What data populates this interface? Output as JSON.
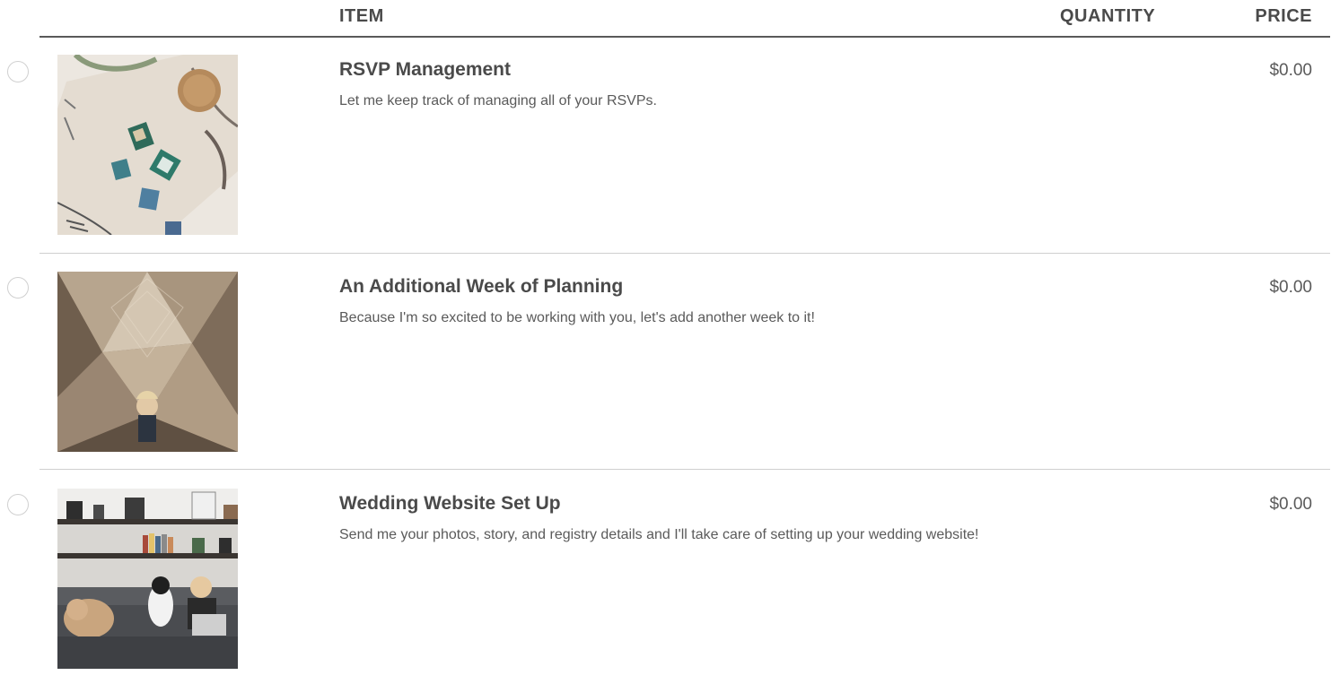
{
  "header": {
    "item": "ITEM",
    "quantity": "QUANTITY",
    "price": "PRICE"
  },
  "items": [
    {
      "title": "RSVP Management",
      "description": "Let me keep track of managing all of your RSVPs.",
      "price": "$0.00",
      "image": "flatlay-stationery-photo"
    },
    {
      "title": "An Additional Week of Planning",
      "description": "Because I'm so excited to be working with you, let's add another week to it!",
      "price": "$0.00",
      "image": "geometric-wood-wall-photo"
    },
    {
      "title": "Wedding Website Set Up",
      "description": "Send me your photos, story, and registry details and I'll take care of setting up your wedding website!",
      "price": "$0.00",
      "image": "couch-laptop-dogs-photo"
    }
  ]
}
